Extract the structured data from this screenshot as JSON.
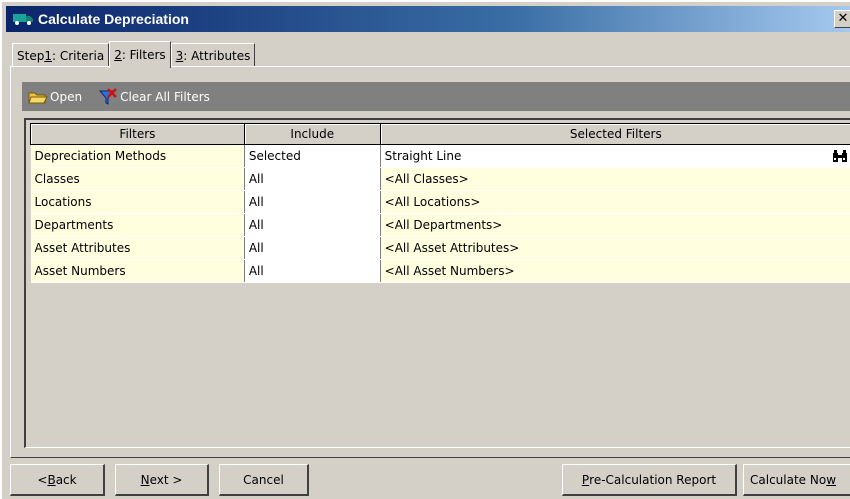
{
  "window": {
    "title": "Calculate Depreciation",
    "close_glyph": "✕"
  },
  "tabs": [
    {
      "prefix": "Step ",
      "hotkey": "1",
      "suffix": ": Criteria"
    },
    {
      "prefix": "",
      "hotkey": "2",
      "suffix": ": Filters"
    },
    {
      "prefix": "",
      "hotkey": "3",
      "suffix": ": Attributes"
    }
  ],
  "toolbar": {
    "open_label": "Open",
    "clear_label": "Clear All Filters"
  },
  "grid": {
    "headers": [
      "Filters",
      "Include",
      "Selected Filters"
    ],
    "rows": [
      {
        "filter": "Depreciation Methods",
        "include": "Selected",
        "selected": "Straight Line"
      },
      {
        "filter": "Classes",
        "include": "All",
        "selected": "<All Classes>"
      },
      {
        "filter": "Locations",
        "include": "All",
        "selected": "<All Locations>"
      },
      {
        "filter": "Departments",
        "include": "All",
        "selected": "<All Departments>"
      },
      {
        "filter": "Asset Attributes",
        "include": "All",
        "selected": "<All Asset Attributes>"
      },
      {
        "filter": "Asset Numbers",
        "include": "All",
        "selected": "<All Asset Numbers>"
      }
    ]
  },
  "buttons": {
    "back": {
      "pre": "< ",
      "hotkey": "B",
      "post": "ack"
    },
    "next": {
      "pre": "",
      "hotkey": "N",
      "post": "ext >"
    },
    "cancel": {
      "label": "Cancel"
    },
    "precalc": {
      "pre": "",
      "hotkey": "P",
      "post": "re-Calculation Report"
    },
    "calcnow": {
      "pre": "Calculate No",
      "hotkey": "w",
      "post": ""
    }
  },
  "colors": {
    "title_start": "#0a246a",
    "title_end": "#a6caf0",
    "toolbar": "#808080",
    "grid_cell": "#ffffe0"
  }
}
